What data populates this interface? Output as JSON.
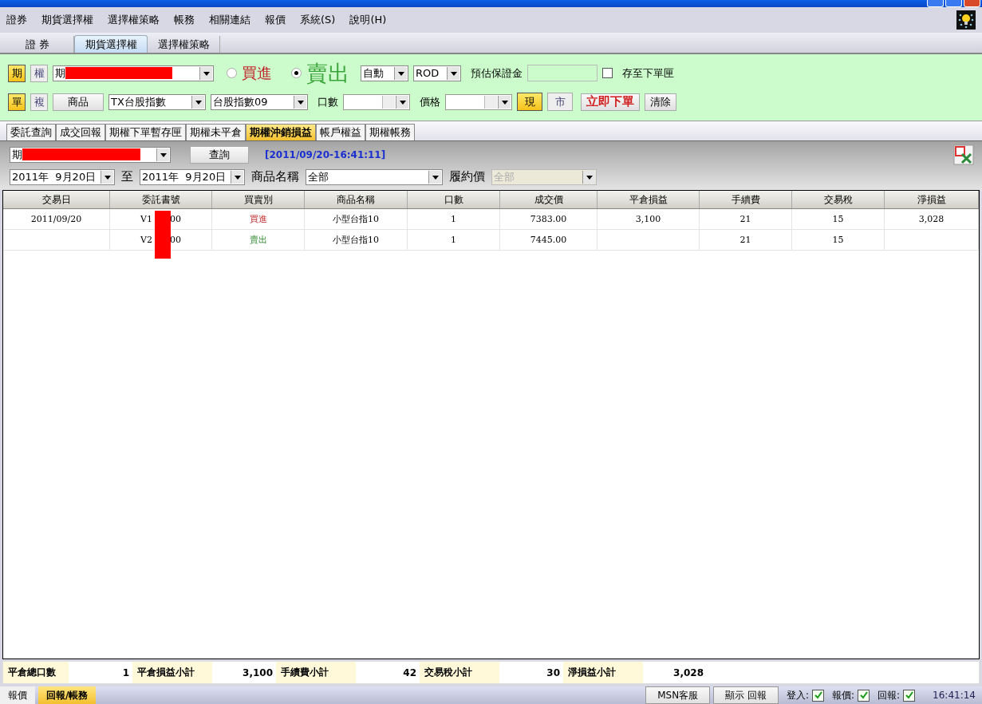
{
  "menu": [
    "證券",
    "期貨選擇權",
    "選擇權策略",
    "帳務",
    "相關連結",
    "報價",
    "系統(S)",
    "說明(H)"
  ],
  "top_tabs": [
    {
      "label": "證 券",
      "selected": false
    },
    {
      "label": "期貨選擇權",
      "selected": true
    },
    {
      "label": "選擇權策略",
      "selected": false
    }
  ],
  "order_panel": {
    "type_toggles": [
      {
        "label": "期",
        "selected": true
      },
      {
        "label": "權",
        "selected": false
      }
    ],
    "account": {
      "value": "期",
      "redacted": true
    },
    "sides": [
      {
        "label": "買進",
        "selected": false,
        "color": "#c0282d"
      },
      {
        "label": "賣出",
        "selected": true,
        "color": "#3aa53a"
      }
    ],
    "condition": "自動",
    "time_in_force": "ROD",
    "margin_label": "預估保證金",
    "save_label": "存至下單匣",
    "save_checked": false,
    "mode_toggles": [
      {
        "label": "單",
        "selected": true
      },
      {
        "label": "複",
        "selected": false
      }
    ],
    "product_button": "商品",
    "product": "TX台股指數",
    "month": "台股指數09",
    "qty_label": "口數",
    "price_label": "價格",
    "price_types": [
      {
        "label": "現",
        "selected": true
      },
      {
        "label": "市",
        "selected": false
      }
    ],
    "submit": "立即下單",
    "clear": "清除"
  },
  "sub_tabs": [
    {
      "label": "委託查詢",
      "selected": false
    },
    {
      "label": "成交回報",
      "selected": false
    },
    {
      "label": "期權下單暫存匣",
      "selected": false
    },
    {
      "label": "期權未平倉",
      "selected": false
    },
    {
      "label": "期權沖銷損益",
      "selected": true
    },
    {
      "label": "帳戶權益",
      "selected": false
    },
    {
      "label": "期權帳務",
      "selected": false
    }
  ],
  "query": {
    "account": {
      "value": "期",
      "redacted": true
    },
    "query_button": "查詢",
    "timestamp": "[2011/09/20-16:41:11]",
    "date_from": "2011年  9月20日",
    "to_label": "至",
    "date_to": "2011年  9月20日",
    "product_label": "商品名稱",
    "product": "全部",
    "strike_label": "履約價",
    "strike": "全部",
    "strike_disabled": true
  },
  "table": {
    "columns": [
      "交易日",
      "委託書號",
      "買賣別",
      "商品名稱",
      "口數",
      "成交價",
      "平倉損益",
      "手續費",
      "交易稅",
      "淨損益"
    ],
    "rows": [
      {
        "trade_date": "2011/09/20",
        "order_no": {
          "prefix": "V1",
          "suffix": "00",
          "redacted": true
        },
        "side": {
          "text": "買進",
          "kind": "buy"
        },
        "product": "小型台指10",
        "qty": "1",
        "price": "7383.00",
        "pnl": "3,100",
        "fee": "21",
        "tax": "15",
        "net": "3,028"
      },
      {
        "trade_date": "",
        "order_no": {
          "prefix": "V2",
          "suffix": "00",
          "redacted": true
        },
        "side": {
          "text": "賣出",
          "kind": "sell"
        },
        "product": "小型台指10",
        "qty": "1",
        "price": "7445.00",
        "pnl": "",
        "fee": "21",
        "tax": "15",
        "net": ""
      }
    ]
  },
  "summary": [
    {
      "label": "平倉總口數",
      "value": "1"
    },
    {
      "label": "平倉損益小計",
      "value": "3,100"
    },
    {
      "label": "手續費小計",
      "value": "42"
    },
    {
      "label": "交易稅小計",
      "value": "30"
    },
    {
      "label": "淨損益小計",
      "value": "3,028"
    }
  ],
  "bottom_tabs": [
    {
      "label": "報價",
      "selected": false
    },
    {
      "label": "回報/帳務",
      "selected": true
    }
  ],
  "status": {
    "buttons": [
      "MSN客服",
      "顯示 回報"
    ],
    "indicators": [
      {
        "label": "登入:",
        "checked": true
      },
      {
        "label": "報價:",
        "checked": true
      },
      {
        "label": "回報:",
        "checked": true
      }
    ],
    "time": "16:41:14"
  }
}
